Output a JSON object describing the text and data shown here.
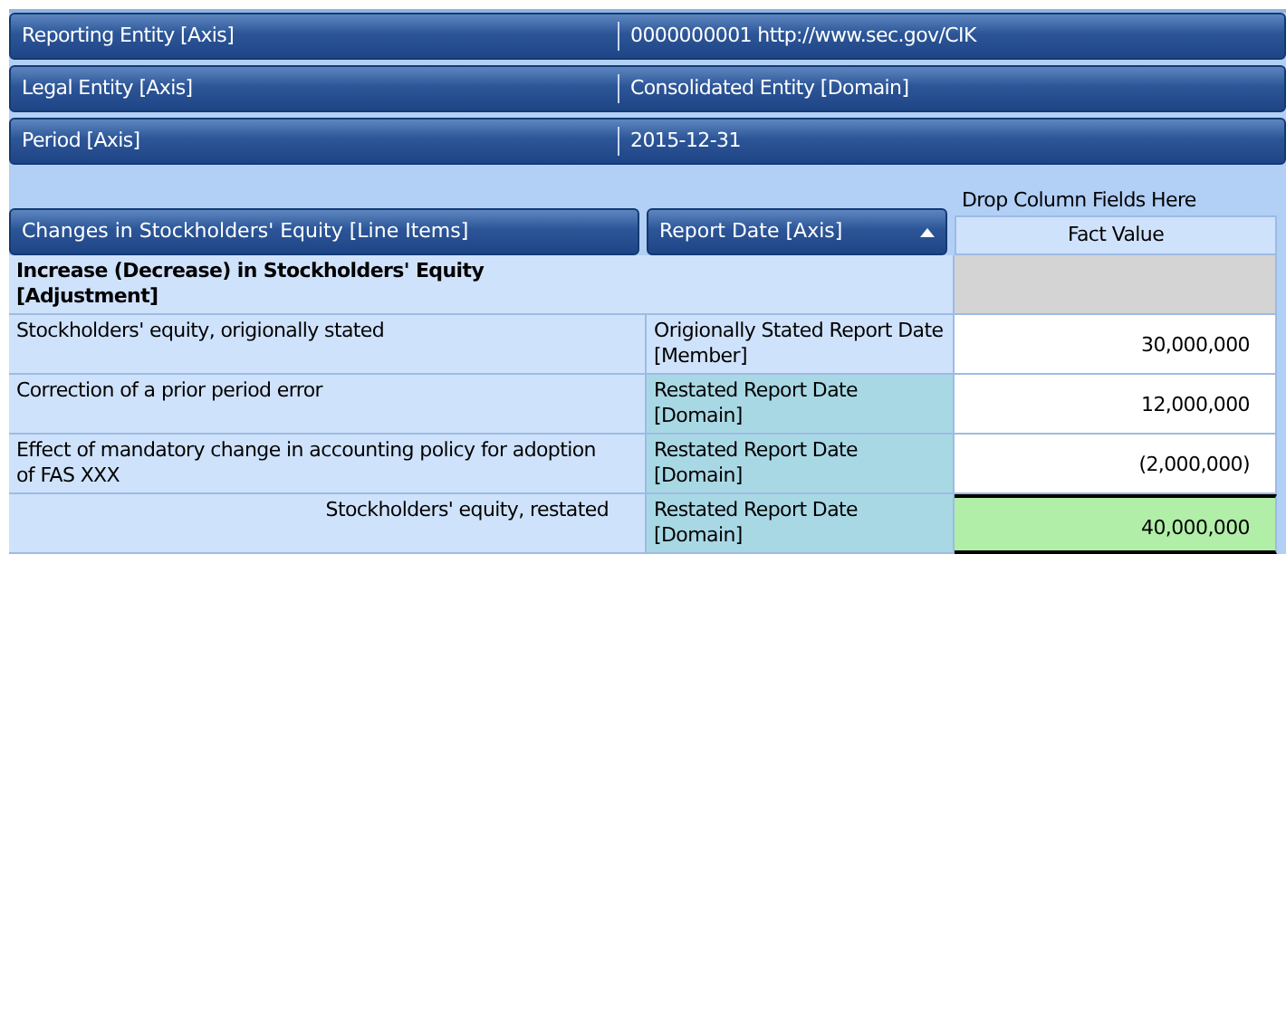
{
  "filters": [
    {
      "axis": "Reporting Entity [Axis]",
      "value": "0000000001 http://www.sec.gov/CIK"
    },
    {
      "axis": "Legal Entity [Axis]",
      "value": "Consolidated Entity [Domain]"
    },
    {
      "axis": "Period [Axis]",
      "value": "2015-12-31"
    }
  ],
  "row_fields": [
    {
      "label": "Changes in Stockholders' Equity [Line Items]",
      "sort_arrow": false
    },
    {
      "label": "Report Date [Axis]",
      "sort_arrow": true
    }
  ],
  "column_drop_hint": "Drop Column Fields Here",
  "data_header": "Fact Value",
  "rows": [
    {
      "kind": "header",
      "label": "Increase (Decrease) in Stockholders' Equity [Adjustment]"
    },
    {
      "kind": "line",
      "label": "Stockholders' equity, origionally stated",
      "member": "Origionally Stated Report Date [Member]",
      "member_highlighted": false,
      "value": "30,000,000"
    },
    {
      "kind": "line",
      "label": "Correction of a prior period error",
      "member": "Restated Report Date [Domain]",
      "member_highlighted": true,
      "value": "12,000,000"
    },
    {
      "kind": "line",
      "label": "Effect of mandatory change in accounting policy for adoption of FAS XXX",
      "member": "Restated Report Date [Domain]",
      "member_highlighted": true,
      "value": "(2,000,000)"
    },
    {
      "kind": "total",
      "label": "Stockholders' equity, restated",
      "member": "Restated Report Date [Domain]",
      "member_highlighted": true,
      "value": "40,000,000"
    }
  ]
}
